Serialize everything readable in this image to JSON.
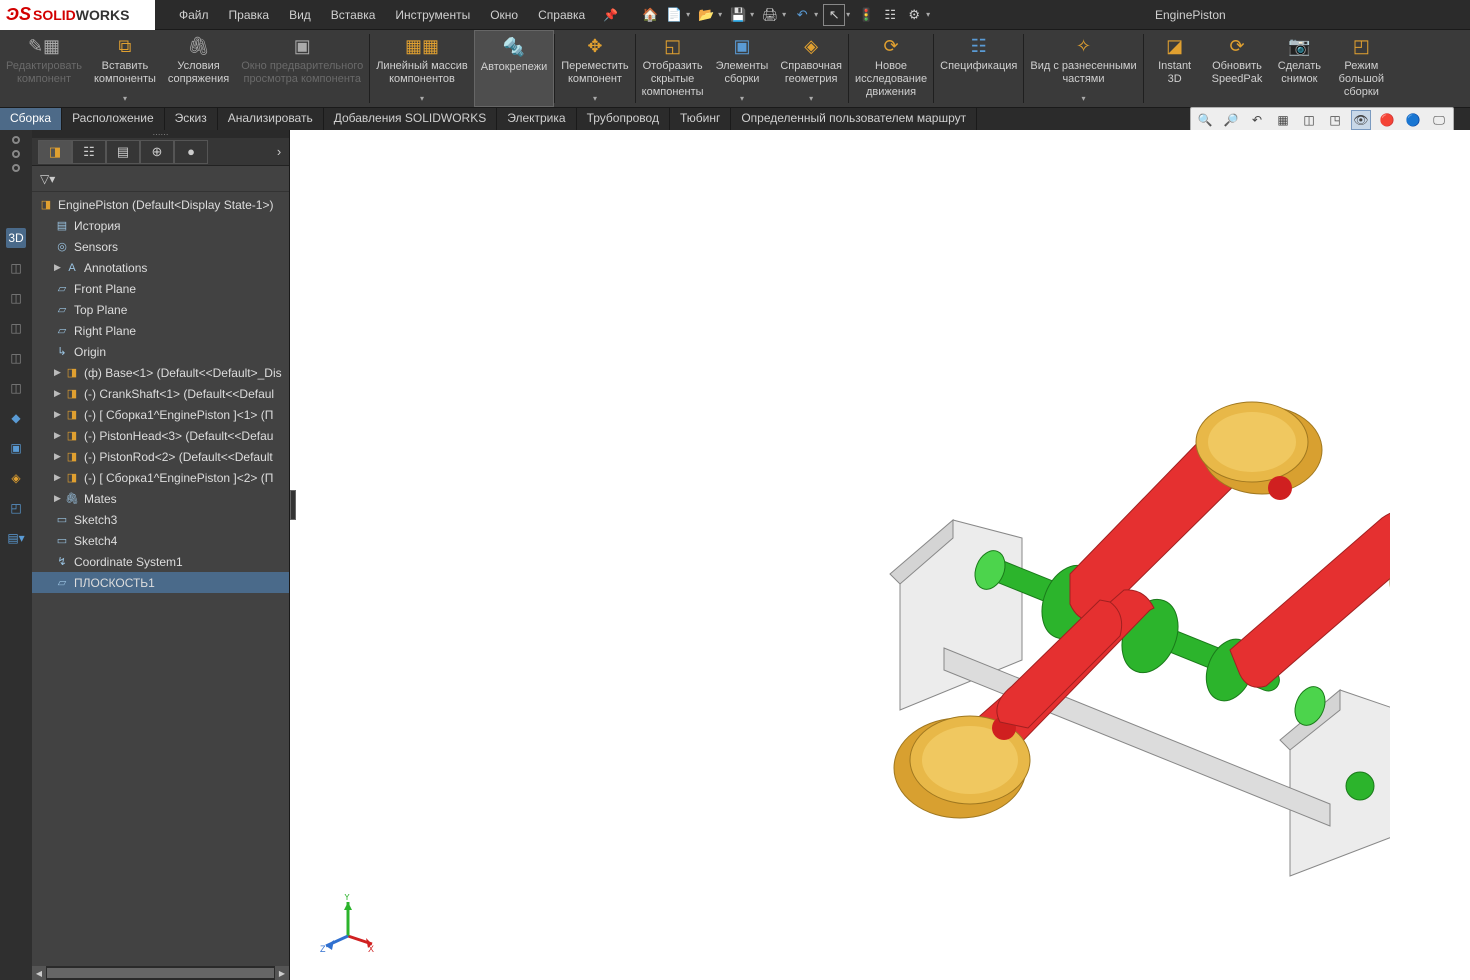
{
  "app": {
    "brand1": "SOLID",
    "brand2": "WORKS",
    "doc_title": "EnginePiston"
  },
  "menu": {
    "file": "Файл",
    "edit": "Правка",
    "view": "Вид",
    "insert": "Вставка",
    "tools": "Инструменты",
    "window": "Окно",
    "help": "Справка"
  },
  "ribbon": {
    "edit_component": "Редактировать\nкомпонент",
    "insert_components": "Вставить\nкомпоненты",
    "mate": "Условия\nсопряжения",
    "preview_window": "Окно предварительного\nпросмотра компонента",
    "linear_pattern": "Линейный массив\nкомпонентов",
    "smart_fasteners": "Автокрепежи",
    "move_component": "Переместить\nкомпонент",
    "show_hidden": "Отобразить\nскрытые\nкомпоненты",
    "assembly_features": "Элементы\nсборки",
    "ref_geometry": "Справочная\nгеометрия",
    "new_motion": "Новое\nисследование\nдвижения",
    "bom": "Спецификация",
    "exploded_view": "Вид с разнесенными\nчастями",
    "instant3d": "Instant\n3D",
    "update_speedpak": "Обновить\nSpeedPak",
    "take_snapshot": "Сделать\nснимок",
    "large_assembly": "Режим\nбольшой\nсборки"
  },
  "tabs": {
    "assembly": "Сборка",
    "layout": "Расположение",
    "sketch": "Эскиз",
    "analyze": "Анализировать",
    "sw_addins": "Добавления SOLIDWORKS",
    "electrical": "Электрика",
    "piping": "Трубопровод",
    "tubing": "Тюбинг",
    "user_route": "Определенный пользователем маршрут"
  },
  "tree": {
    "root": "EnginePiston  (Default<Display State-1>)",
    "history": "История",
    "sensors": "Sensors",
    "annotations": "Annotations",
    "front": "Front Plane",
    "top": "Top Plane",
    "right": "Right Plane",
    "origin": "Origin",
    "base": "(ф) Base<1> (Default<<Default>_Dis",
    "crankshaft": "(-) CrankShaft<1> (Default<<Defaul",
    "sub1": "(-) [ Сборка1^EnginePiston ]<1> (П",
    "pistonhead": "(-) PistonHead<3> (Default<<Defau",
    "pistonrod": "(-) PistonRod<2> (Default<<Default",
    "sub2": "(-) [ Сборка1^EnginePiston ]<2> (П",
    "mates": "Mates",
    "sketch3": "Sketch3",
    "sketch4": "Sketch4",
    "csys": "Coordinate System1",
    "plane1": "ПЛОСКОСТЬ1"
  },
  "triad": {
    "x": "X",
    "y": "Y",
    "z": "Z"
  }
}
